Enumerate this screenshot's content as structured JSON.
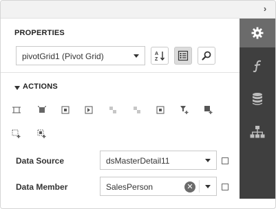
{
  "header": {
    "collapse_glyph": "›"
  },
  "properties": {
    "title": "PROPERTIES",
    "component_select": "pivotGrid1 (Pivot Grid)",
    "sort_icon": "sort-alpha-icon",
    "categories_icon": "categories-icon",
    "search_icon": "search-icon"
  },
  "actions": {
    "title": "ACTIONS",
    "tools": [
      "align-edges-icon",
      "align-center-icon",
      "fit-bounds-icon",
      "fit-width-icon",
      "disabled-tool-a-icon",
      "disabled-tool-b-icon",
      "center-icon",
      "add-field-icon",
      "add-row-icon",
      "add-column-icon",
      "add-data-icon"
    ]
  },
  "fields": {
    "data_source_label": "Data Source",
    "data_source_value": "dsMasterDetail11",
    "data_member_label": "Data Member",
    "data_member_value": "SalesPerson",
    "clear_glyph": "✕"
  },
  "sidebar": {
    "tabs": [
      "gear-icon",
      "expression-icon",
      "database-icon",
      "hierarchy-icon"
    ]
  },
  "colors": {
    "sidebar_bg": "#3f3f3f",
    "sidebar_active": "#6b6b6b",
    "border": "#c9c9c9"
  }
}
